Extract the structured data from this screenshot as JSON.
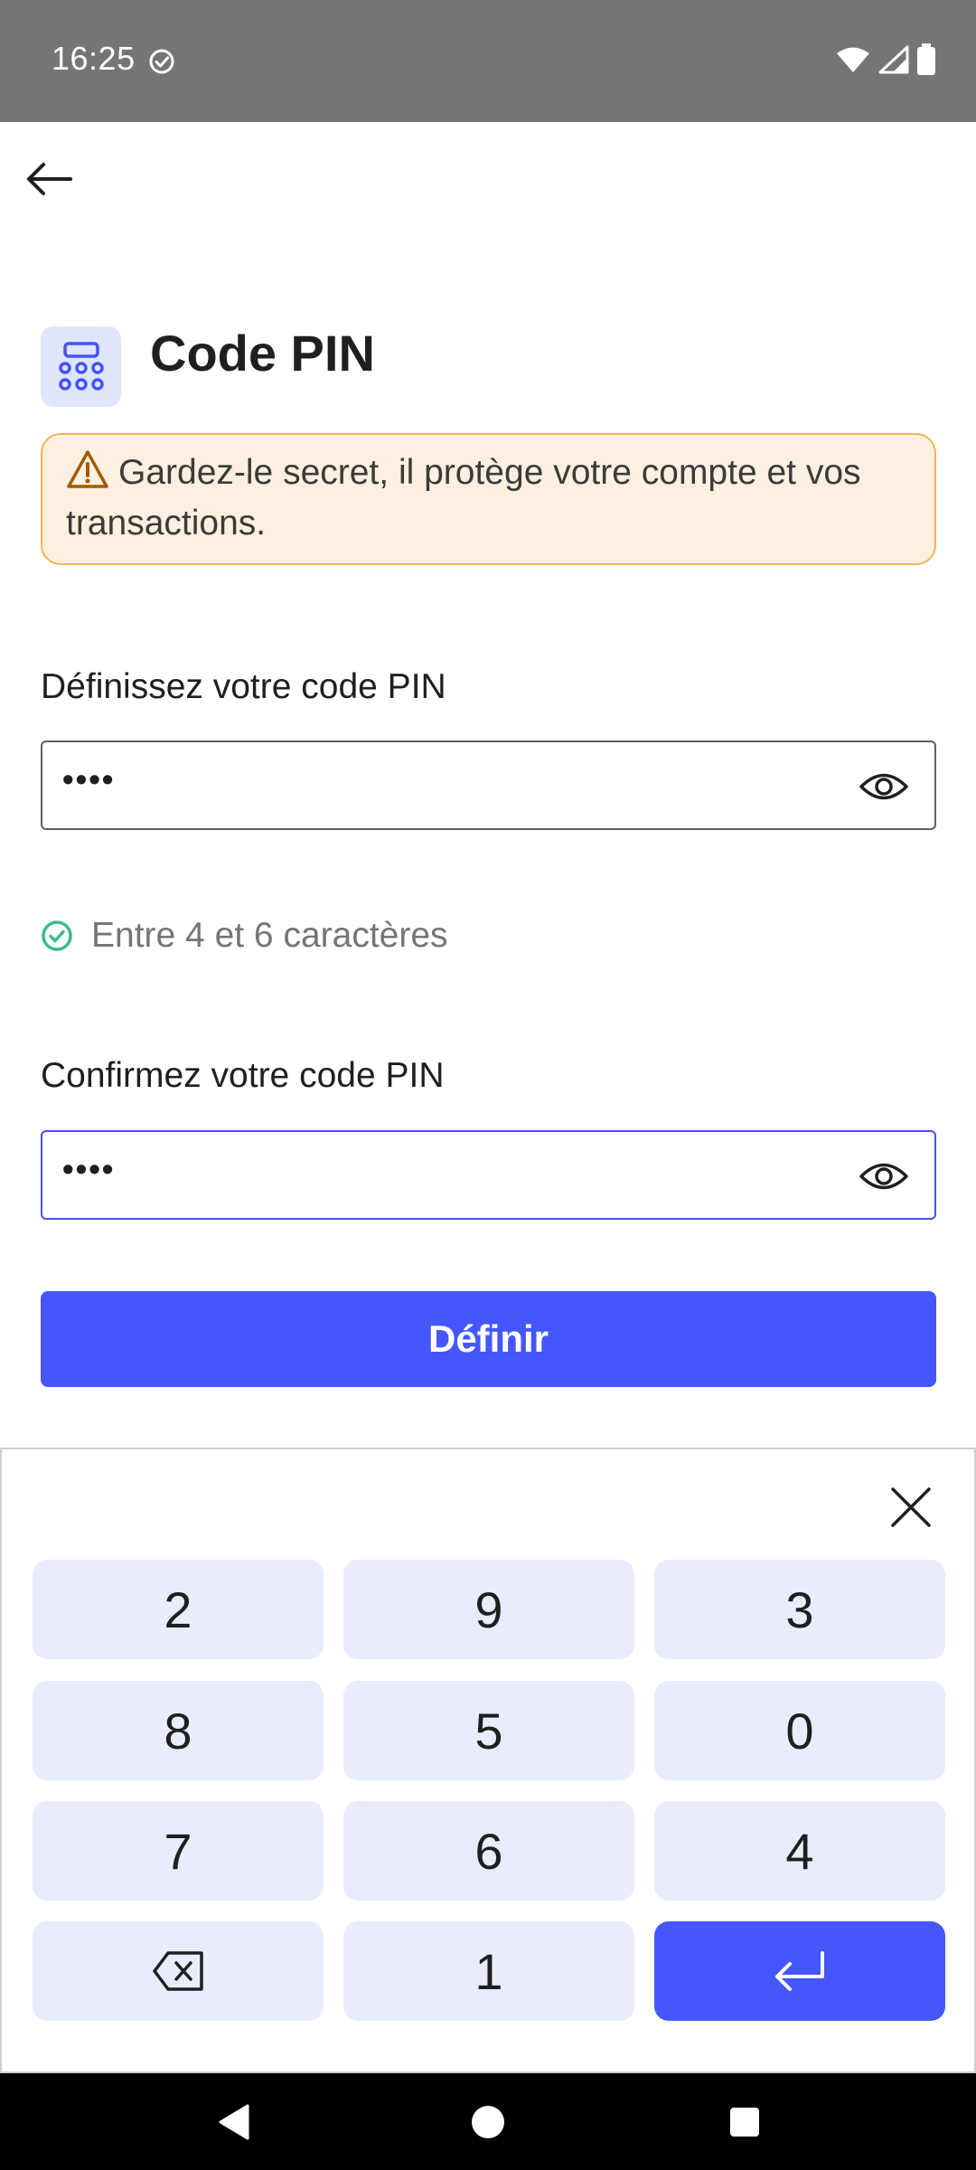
{
  "status_bar": {
    "time": "16:25",
    "icons": [
      "check-circle-icon",
      "wifi-icon",
      "signal-icon",
      "battery-icon"
    ]
  },
  "header": {
    "back_icon": "arrow-left-icon"
  },
  "title": {
    "icon": "keypad-icon",
    "text": "Code PIN"
  },
  "warning": {
    "icon": "warning-icon",
    "text": "Gardez-le secret, il protège votre compte et vos transactions."
  },
  "pin_field": {
    "label": "Définissez votre code PIN",
    "value": "••••",
    "toggle_icon": "eye-icon"
  },
  "hint": {
    "icon": "check-circle-icon",
    "text": "Entre 4 et 6 caractères"
  },
  "confirm_field": {
    "label": "Confirmez votre code PIN",
    "value": "••••",
    "toggle_icon": "eye-icon"
  },
  "submit": {
    "label": "Définir"
  },
  "keypad": {
    "close_icon": "close-icon",
    "keys": [
      "2",
      "9",
      "3",
      "8",
      "5",
      "0",
      "7",
      "6",
      "4",
      "backspace",
      "1",
      "enter"
    ]
  },
  "colors": {
    "accent": "#4556fb",
    "warning_bg": "#fdf0e0",
    "warning_border": "#f6b352",
    "success": "#3cba92",
    "key_bg": "#e9ecfd",
    "status_bar": "#757575"
  }
}
